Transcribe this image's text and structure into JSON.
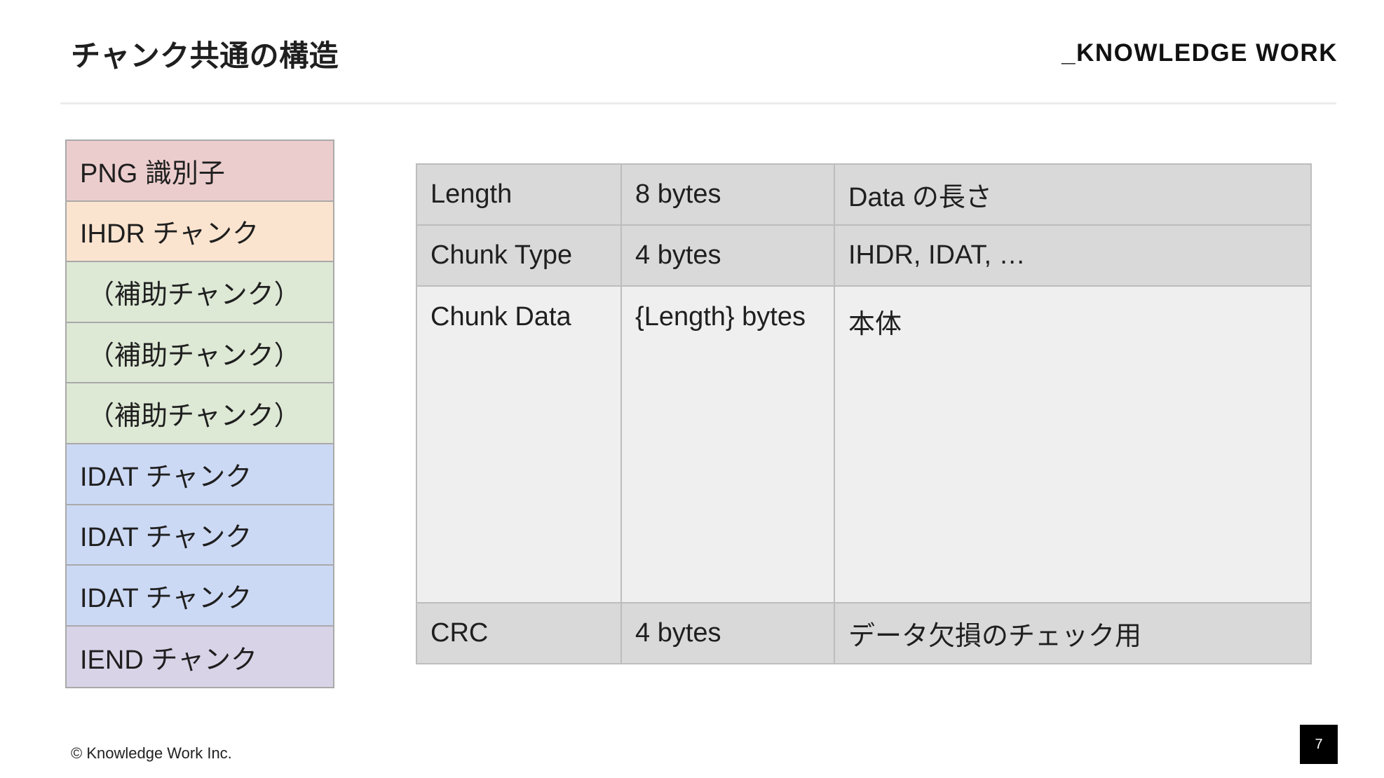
{
  "header": {
    "title": "チャンク共通の構造",
    "brand": "_KNOWLEDGE WORK"
  },
  "chunk_stack": [
    {
      "label": "PNG 識別子",
      "kind": "signature",
      "color": "#eccdcd"
    },
    {
      "label": "IHDR チャンク",
      "kind": "ihdr",
      "color": "#fbe4cf"
    },
    {
      "label": "（補助チャンク）",
      "kind": "ancillary",
      "color": "#dde8d5"
    },
    {
      "label": "（補助チャンク）",
      "kind": "ancillary",
      "color": "#dde8d5"
    },
    {
      "label": "（補助チャンク）",
      "kind": "ancillary",
      "color": "#dde8d5"
    },
    {
      "label": "IDAT チャンク",
      "kind": "idat",
      "color": "#ccd9f4"
    },
    {
      "label": "IDAT チャンク",
      "kind": "idat",
      "color": "#ccd9f4"
    },
    {
      "label": "IDAT チャンク",
      "kind": "idat",
      "color": "#ccd9f4"
    },
    {
      "label": "IEND チャンク",
      "kind": "iend",
      "color": "#d9d3e8"
    }
  ],
  "structure_table": {
    "rows": [
      {
        "field": "Length",
        "size": "8 bytes",
        "description": "Data の長さ"
      },
      {
        "field": "Chunk Type",
        "size": "4 bytes",
        "description": "IHDR, IDAT, …"
      },
      {
        "field": "Chunk Data",
        "size": "{Length} bytes",
        "description": "本体"
      },
      {
        "field": "CRC",
        "size": "4 bytes",
        "description": "データ欠損のチェック用"
      }
    ]
  },
  "footer": {
    "copyright": "© Knowledge Work Inc.",
    "page_number": "7"
  }
}
